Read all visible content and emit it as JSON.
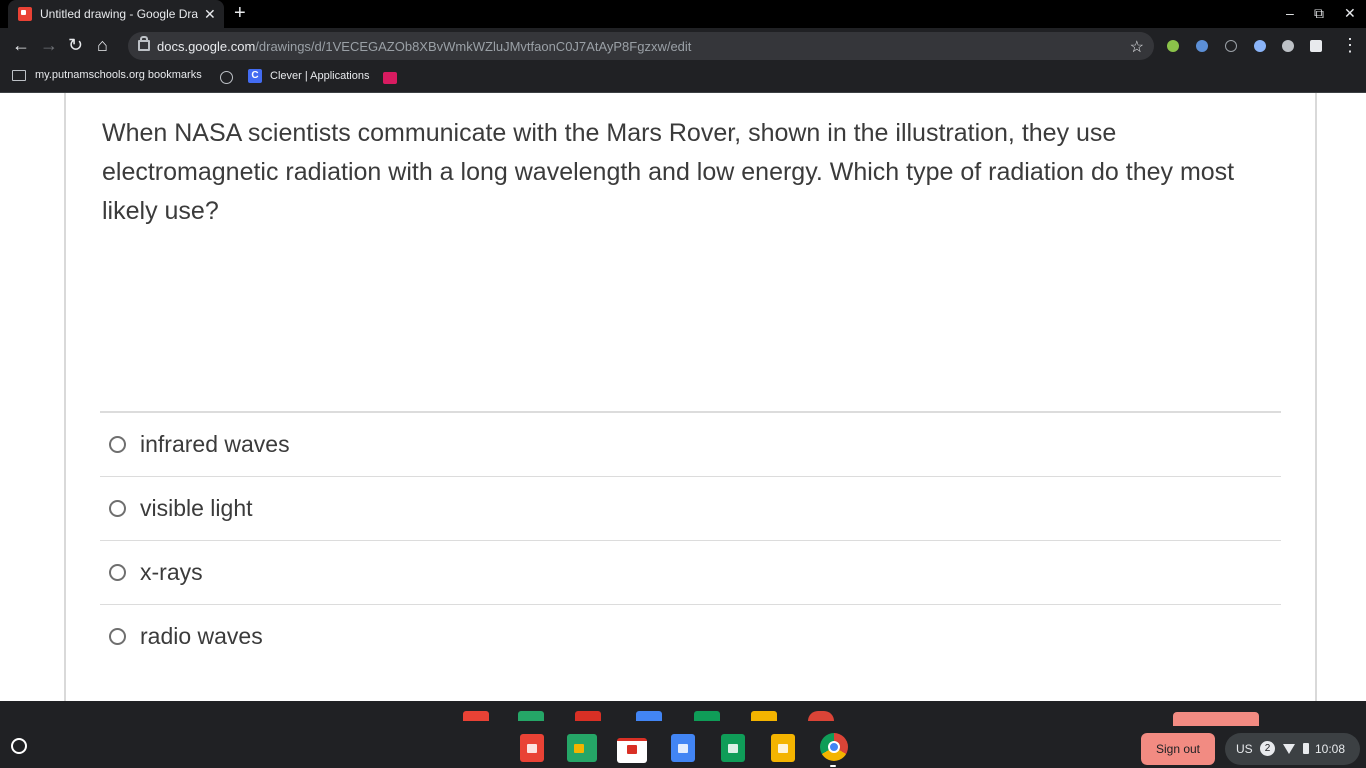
{
  "browser": {
    "tab_title": "Untitled drawing - Google Drawi",
    "tab_close": "✕",
    "new_tab": "+",
    "url_host": "docs.google.com",
    "url_path": "/drawings/d/1VECEGAZOb8XBvWmkWZluJMvtfaonC0J7AtAyP8Fgzxw/edit",
    "bookmarks": [
      {
        "label": "my.putnamschools.org bookmarks",
        "icon": "folder-icon"
      },
      {
        "label": "",
        "icon": "globe-icon"
      },
      {
        "label": "Clever | Applications",
        "icon": "clever-icon"
      },
      {
        "label": "",
        "icon": "app-icon"
      }
    ],
    "clever_letter": "C",
    "window_controls": {
      "minimize": "–",
      "maximize": "⧉",
      "close": "✕"
    },
    "nav": {
      "back": "←",
      "forward": "→",
      "reload": "↻",
      "home": "⌂",
      "star": "☆",
      "menu": "⋮"
    }
  },
  "quiz": {
    "question": "When NASA scientists communicate with the Mars Rover, shown in the illustration, they use electromagnetic radiation with a long wavelength and low energy. Which type of radiation do they most likely use?",
    "answers": [
      {
        "label": "infrared waves"
      },
      {
        "label": "visible light"
      },
      {
        "label": "x-rays"
      },
      {
        "label": "radio waves"
      }
    ]
  },
  "shelf": {
    "sign_out": "Sign out",
    "keyboard_layout": "US",
    "notification_count": "2",
    "time": "10:08",
    "apps": [
      "drawings-app",
      "classroom-app",
      "gmail-app",
      "docs-app",
      "sheets-app",
      "slides-app",
      "chrome-app"
    ]
  },
  "colors": {
    "chrome_dark": "#202124",
    "omnibox": "#35363a",
    "sign_out": "#f28b82",
    "drawings_red": "#e94235",
    "docs_blue": "#4285f4",
    "sheets_green": "#0f9d58",
    "slides_yellow": "#f4b400",
    "classroom_green": "#25a667"
  }
}
